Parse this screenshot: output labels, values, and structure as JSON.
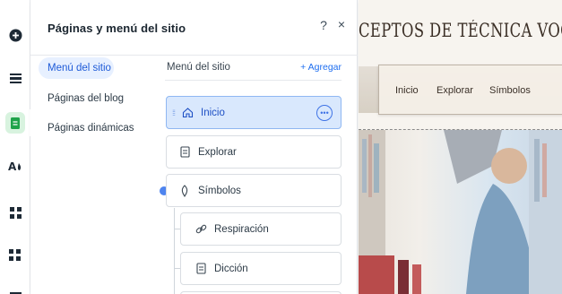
{
  "colors": {
    "accent": "#1f6ff0",
    "selected_bg": "#d9e8fd",
    "active_nav_bg": "#e7f0ff",
    "editor_green": "#d8f3df"
  },
  "toolbar": {
    "icons": [
      "add-icon",
      "menu-icon",
      "pages-icon",
      "theme-icon",
      "apps-icon",
      "puzzle-icon",
      "more-icon"
    ]
  },
  "panel": {
    "title": "Páginas y menú del sitio",
    "help": "?",
    "close": "×"
  },
  "nav": {
    "items": [
      "Menú del sitio",
      "Páginas del blog",
      "Páginas dinámicas"
    ],
    "active_index": 0
  },
  "content": {
    "title": "Menú del sitio",
    "add_label": "+ Agregar",
    "rows": [
      {
        "label": "Inicio",
        "icon": "home-icon",
        "selected": true
      },
      {
        "label": "Explorar",
        "icon": "page-icon",
        "selected": false
      },
      {
        "label": "Símbolos",
        "icon": "folder-icon",
        "selected": false
      },
      {
        "label": "Respiración",
        "icon": "link-icon",
        "selected": false
      },
      {
        "label": "Dicción",
        "icon": "page-icon",
        "selected": false
      }
    ]
  },
  "preview": {
    "heading": "CEPTOS DE TÉCNICA VOCAL CON M",
    "menu": [
      "Inicio",
      "Explorar",
      "Símbolos"
    ]
  }
}
